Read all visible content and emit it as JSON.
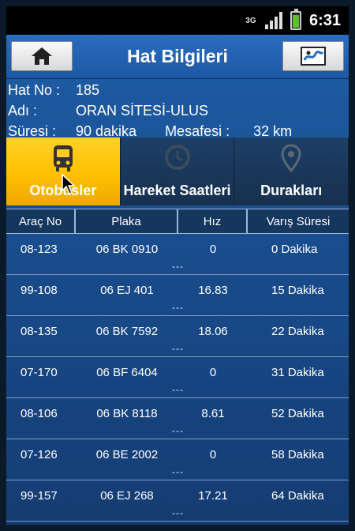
{
  "statusbar": {
    "network": "3G",
    "time": "6:31"
  },
  "header": {
    "title": "Hat Bilgileri",
    "home_icon": "home-icon",
    "map_icon": "map-icon"
  },
  "line_info": {
    "hat_no_label": "Hat No :",
    "hat_no": "185",
    "adi_label": "Adı :",
    "adi": "ORAN SİTESİ-ULUS",
    "suresi_label": "Süresi :",
    "suresi": "90 dakika",
    "mesafesi_label": "Mesafesi :",
    "mesafesi": "32 km"
  },
  "tabs": [
    {
      "label": "Otobüsler",
      "icon": "bus-icon",
      "active": true
    },
    {
      "label": "Hareket Saatleri",
      "icon": "clock-icon",
      "active": false
    },
    {
      "label": "Durakları",
      "icon": "map-pin-icon",
      "active": false
    }
  ],
  "table": {
    "headers": [
      "Araç No",
      "Plaka",
      "Hız",
      "Varış Süresi"
    ],
    "rows": [
      {
        "arac": "08-123",
        "plaka": "06 BK 0910",
        "hiz": "0",
        "varis": "0 Dakika",
        "extra": "---"
      },
      {
        "arac": "99-108",
        "plaka": "06 EJ 401",
        "hiz": "16.83",
        "varis": "15 Dakika",
        "extra": "---"
      },
      {
        "arac": "08-135",
        "plaka": "06 BK 7592",
        "hiz": "18.06",
        "varis": "22 Dakika",
        "extra": "---"
      },
      {
        "arac": "07-170",
        "plaka": "06 BF 6404",
        "hiz": "0",
        "varis": "31 Dakika",
        "extra": "---"
      },
      {
        "arac": "08-106",
        "plaka": "06 BK 8118",
        "hiz": "8.61",
        "varis": "52 Dakika",
        "extra": "---"
      },
      {
        "arac": "07-126",
        "plaka": "06 BE 2002",
        "hiz": "0",
        "varis": "58 Dakika",
        "extra": "---"
      },
      {
        "arac": "99-157",
        "plaka": "06 EJ 268",
        "hiz": "17.21",
        "varis": "64 Dakika",
        "extra": "---"
      }
    ]
  },
  "colors": {
    "accent": "#ffc107",
    "background": "#1a4f92",
    "header_bar": "#2a6cc0"
  }
}
